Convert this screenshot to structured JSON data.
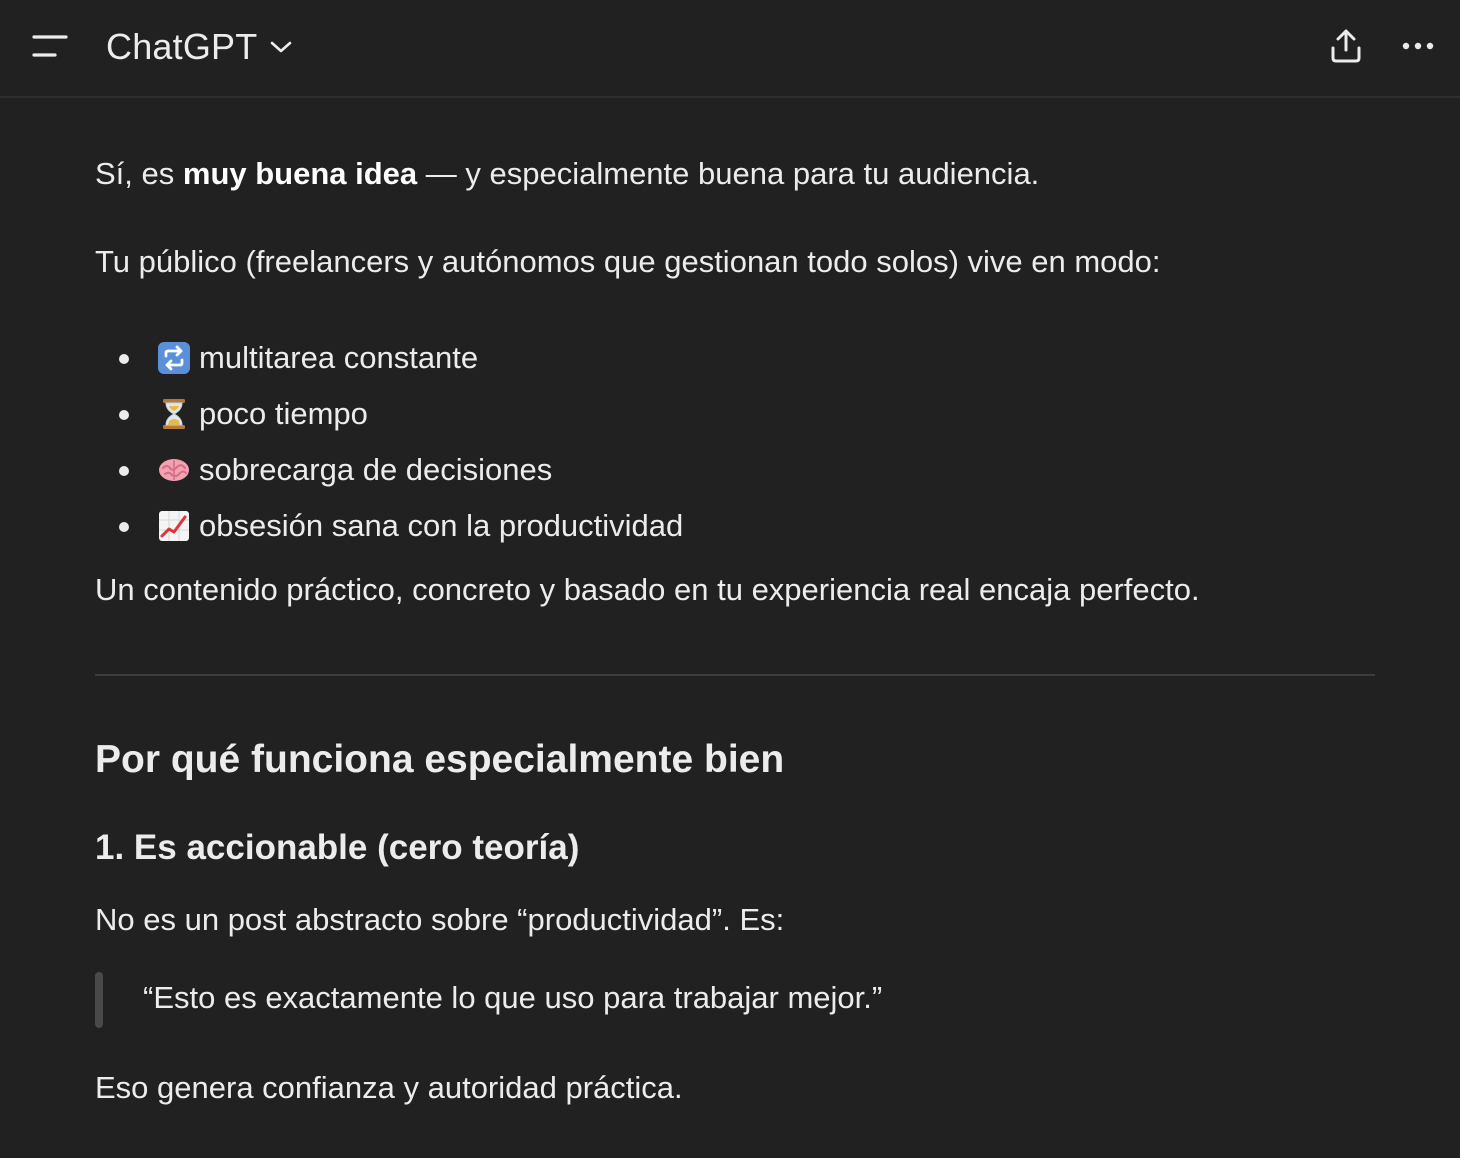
{
  "header": {
    "model_name": "ChatGPT",
    "icons": {
      "menu": "sidebar-menu-icon",
      "model_chevron": "chevron-down-icon",
      "share": "share-upload-icon",
      "more": "more-options-icon"
    }
  },
  "message": {
    "intro": {
      "prefix": "Sí, es ",
      "bold": "muy buena idea",
      "suffix": " — y especialmente buena para tu audiencia."
    },
    "audience_line": "Tu público (freelancers y autónomos que gestionan todo solos) vive en modo:",
    "bullets": [
      {
        "icon": "repeat-icon",
        "text": "multitarea constante"
      },
      {
        "icon": "hourglass-icon",
        "text": "poco tiempo"
      },
      {
        "icon": "brain-icon",
        "text": "sobrecarga de decisiones"
      },
      {
        "icon": "chart-increasing-icon",
        "text": "obsesión sana con la productividad"
      }
    ],
    "summary_line": "Un contenido práctico, concreto y basado en tu experiencia real encaja perfecto.",
    "section_heading": "Por qué funciona especialmente bien",
    "subheading": "1. Es accionable (cero teoría)",
    "subheading_body": "No es un post abstracto sobre “productividad”. Es:",
    "quote": "“Esto es exactamente lo que uso para trabajar mejor.”",
    "closing_line": "Eso genera confianza y autoridad práctica."
  },
  "colors": {
    "background": "#212121",
    "text": "#ececec",
    "divider": "#3c3c3c",
    "quote_bar": "#4a4a4a"
  }
}
